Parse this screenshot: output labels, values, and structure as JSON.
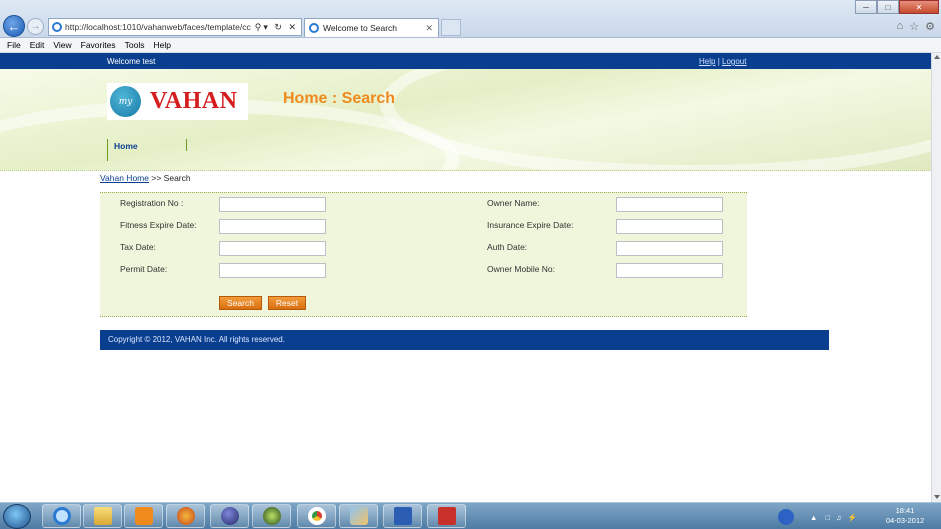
{
  "browser": {
    "url": "http://localhost:1010/vahanweb/faces/template/cc",
    "tab_title": "Welcome to Search",
    "menu": [
      "File",
      "Edit",
      "View",
      "Favorites",
      "Tools",
      "Help"
    ]
  },
  "header": {
    "welcome": "Welcome test",
    "help": "Help",
    "separator": "|",
    "logout": "Logout",
    "logo_my": "my",
    "logo_text": "VAHAN",
    "page_title": "Home : Search",
    "nav_home": "Home"
  },
  "breadcrumb": {
    "link": "Vahan Home",
    "separator": ">>",
    "current": "Search"
  },
  "form": {
    "left": [
      {
        "label": "Registration No :",
        "value": ""
      },
      {
        "label": "Fitness Expire Date:",
        "value": ""
      },
      {
        "label": "Tax Date:",
        "value": ""
      },
      {
        "label": "Permit Date:",
        "value": ""
      }
    ],
    "right": [
      {
        "label": "Owner Name:",
        "value": ""
      },
      {
        "label": "Insurance Expire Date:",
        "value": ""
      },
      {
        "label": "Auth Date:",
        "value": ""
      },
      {
        "label": "Owner Mobile No:",
        "value": ""
      }
    ],
    "search_label": "Search",
    "reset_label": "Reset"
  },
  "footer": {
    "copyright": "Copyright ©  2012, VAHAN Inc. All rights reserved."
  },
  "taskbar": {
    "time": "18:41",
    "date": "04-03-2012"
  },
  "colors": {
    "brand_blue": "#0a3f8f",
    "accent_orange": "#f08a1c",
    "logo_red": "#d51d1d",
    "form_bg": "#eff6dc"
  }
}
